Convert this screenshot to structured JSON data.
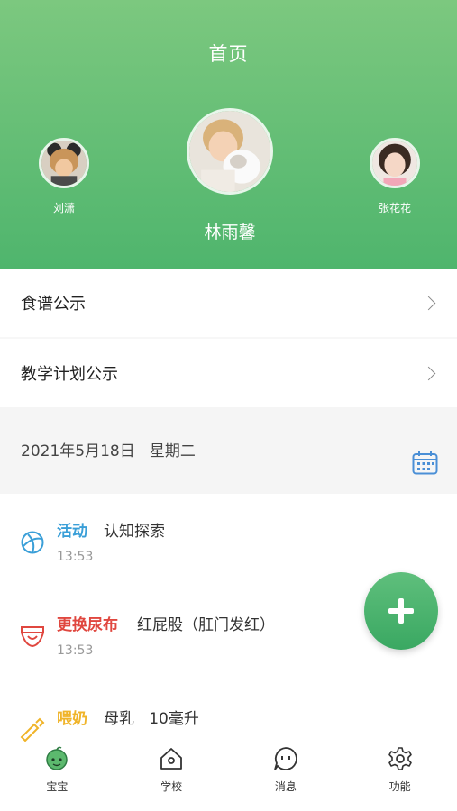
{
  "header": {
    "title": "首页",
    "kids": [
      {
        "name": "刘潇"
      },
      {
        "name": "林雨馨"
      },
      {
        "name": "张花花"
      }
    ]
  },
  "menu": [
    {
      "label": "食谱公示"
    },
    {
      "label": "教学计划公示"
    }
  ],
  "date": {
    "text": "2021年5月18日   星期二"
  },
  "events": [
    {
      "type": "活动",
      "detail": "认知探索",
      "time": "13:53",
      "color": "#3a9fd8",
      "icon": "ball-icon"
    },
    {
      "type": "更换尿布",
      "detail": "红屁股（肛门发红）",
      "time": "13:53",
      "color": "#e0473f",
      "icon": "diaper-icon"
    },
    {
      "type": "喂奶",
      "detail": "母乳   10毫升",
      "time": "",
      "color": "#f0b429",
      "icon": "bottle-icon"
    }
  ],
  "tabs": [
    {
      "label": "宝宝",
      "icon": "baby-icon"
    },
    {
      "label": "学校",
      "icon": "school-icon"
    },
    {
      "label": "消息",
      "icon": "message-icon"
    },
    {
      "label": "功能",
      "icon": "gear-icon"
    }
  ],
  "colors": {
    "header_top": "#7cc87f",
    "header_bottom": "#4fb56d",
    "accent_green": "#3aa862",
    "calendar_blue": "#4a8fd6"
  }
}
